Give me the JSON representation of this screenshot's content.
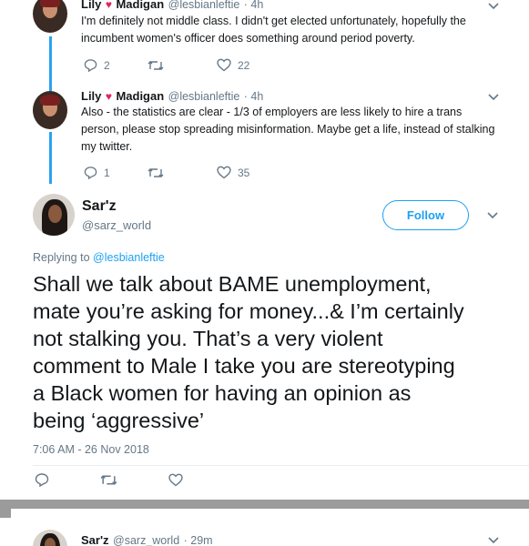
{
  "tweets": [
    {
      "name": "Lily",
      "name_second": "Madigan",
      "name_icon": "rose-icon",
      "handle": "@lesbianleftie",
      "time": "· 4h",
      "text_line1": "I'm definitely not middle class. I didn't get elected unfortunately, hopefully the",
      "text_line2": "incumbent women's officer does something around period poverty.",
      "replies": "2",
      "retweets": "",
      "likes": "22"
    },
    {
      "name": "Lily",
      "name_second": "Madigan",
      "name_icon": "rose-icon",
      "handle": "@lesbianleftie",
      "time": "· 4h",
      "text_line1": "Also - the statistics are clear - 1/3 of employers are less likely to hire a trans",
      "text_line2": "person, please stop spreading misinformation. Maybe get a life, instead of stalking",
      "text_line3": "my twitter.",
      "replies": "1",
      "retweets": "",
      "likes": "35"
    }
  ],
  "main_tweet": {
    "name": "Sar'z",
    "handle": "@sarz_world",
    "follow_label": "Follow",
    "replying_prefix": "Replying to",
    "replying_to": "@lesbianleftie",
    "text_lines": [
      "Shall we talk about BAME unemployment,",
      "mate you’re asking for money...& I’m certainly",
      "not stalking you. That’s a very violent",
      "comment to Male I take you are stereotyping",
      "a Black women for having an opinion as",
      "being ‘aggressive’"
    ],
    "timestamp": "7:06 AM - 26 Nov 2018"
  },
  "next_tweet": {
    "name": "Sar'z",
    "handle": "@sarz_world",
    "time": "· 29m"
  },
  "colors": {
    "accent": "#1da1f2",
    "thread_line": "#2aa3ef",
    "muted": "#657786",
    "rose": "#e0245e"
  }
}
